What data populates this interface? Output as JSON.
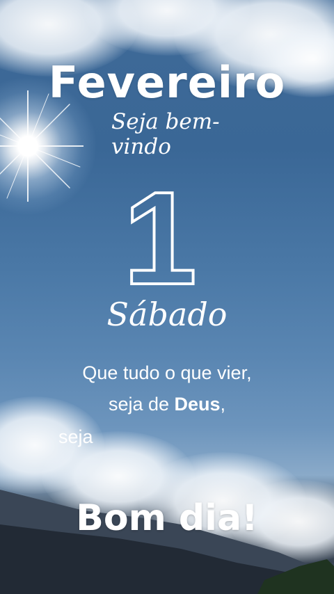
{
  "month": "Fevereiro",
  "welcome": "Seja bem-vindo",
  "day_number": "1",
  "weekday": "Sábado",
  "quote": {
    "line1": "Que tudo o que vier,",
    "line2_prefix": "seja de ",
    "line2_bold": "Deus",
    "line2_suffix": ",",
    "line3": "seja"
  },
  "greeting": "Bom dia!",
  "colors": {
    "text": "#ffffff",
    "sky": "#3f6a98"
  },
  "icons": {
    "sun": "sun-flare-icon"
  }
}
